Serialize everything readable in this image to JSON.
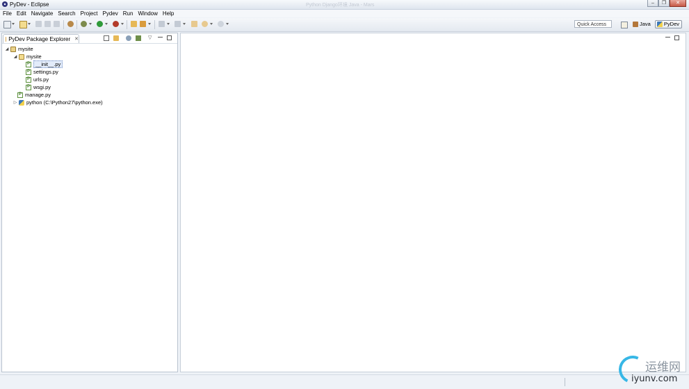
{
  "window": {
    "title": "PyDev - Eclipse",
    "ghost_title": "Python Django环境 Java - Mars"
  },
  "menu": [
    {
      "label": "File"
    },
    {
      "label": "Edit"
    },
    {
      "label": "Navigate"
    },
    {
      "label": "Search"
    },
    {
      "label": "Project"
    },
    {
      "label": "Pydev"
    },
    {
      "label": "Run"
    },
    {
      "label": "Window"
    },
    {
      "label": "Help"
    }
  ],
  "toolbar": {
    "quick_access": "Quick Access",
    "perspectives": {
      "java": "Java",
      "pydev": "PyDev"
    }
  },
  "explorer": {
    "tab_label": "PyDev Package Explorer",
    "close_glyph": "✕",
    "tree": [
      {
        "label": "mysite",
        "kind": "project",
        "twisty": "◢",
        "indent": 0
      },
      {
        "label": "mysite",
        "kind": "folder",
        "twisty": "◢",
        "indent": 1
      },
      {
        "label": "__init__.py",
        "kind": "pyfile",
        "twisty": "",
        "indent": 2,
        "selected": true
      },
      {
        "label": "settings.py",
        "kind": "pyfile",
        "twisty": "",
        "indent": 2
      },
      {
        "label": "urls.py",
        "kind": "pyfile",
        "twisty": "",
        "indent": 2
      },
      {
        "label": "wsgi.py",
        "kind": "pyfile",
        "twisty": "",
        "indent": 2
      },
      {
        "label": "manage.py",
        "kind": "pyfile",
        "twisty": "",
        "indent": 1
      },
      {
        "label": "python  (C:\\Python27\\python.exe)",
        "kind": "python",
        "twisty": "▷",
        "indent": 0
      }
    ]
  },
  "watermark": {
    "cn": "运维网",
    "en": "iyunv.com"
  },
  "colors": {
    "accent": "#37b7e6",
    "pyfile_green": "#3f7a22"
  }
}
